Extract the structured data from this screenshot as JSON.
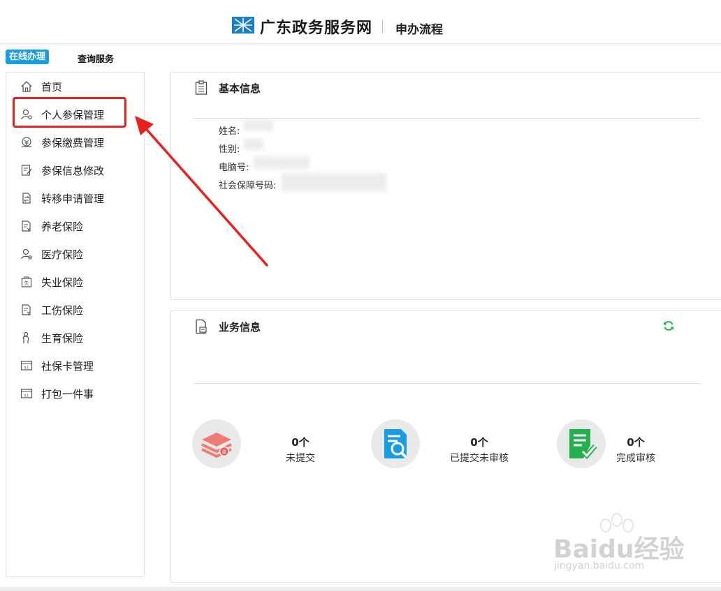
{
  "header": {
    "site_name": "广东政务服务网",
    "subtitle": "申办流程"
  },
  "top_tabs": {
    "online": "在线办理",
    "query": "查询服务"
  },
  "sidebar": {
    "items": [
      {
        "label": "首页",
        "icon": "home-icon"
      },
      {
        "label": "个人参保管理",
        "icon": "user-gear-icon"
      },
      {
        "label": "参保缴费管理",
        "icon": "payment-icon"
      },
      {
        "label": "参保信息修改",
        "icon": "edit-doc-icon"
      },
      {
        "label": "转移申请管理",
        "icon": "transfer-icon"
      },
      {
        "label": "养老保险",
        "icon": "pension-doc-icon"
      },
      {
        "label": "医疗保险",
        "icon": "medical-user-icon"
      },
      {
        "label": "失业保险",
        "icon": "unemployment-icon"
      },
      {
        "label": "工伤保险",
        "icon": "injury-doc-icon"
      },
      {
        "label": "生育保险",
        "icon": "maternity-icon"
      },
      {
        "label": "社保卡管理",
        "icon": "si-card-icon"
      },
      {
        "label": "打包一件事",
        "icon": "si-card-icon"
      }
    ],
    "highlighted_index": 1
  },
  "basic_info": {
    "title": "基本信息",
    "fields": [
      {
        "label": "姓名:"
      },
      {
        "label": "性别:"
      },
      {
        "label": "电脑号:"
      },
      {
        "label": "社会保障号码:"
      }
    ]
  },
  "business_info": {
    "title": "业务信息",
    "stats": [
      {
        "count": "0个",
        "label": "未提交",
        "icon": "unsubmitted-stack-icon"
      },
      {
        "count": "0个",
        "label": "已提交未审核",
        "icon": "search-doc-icon"
      },
      {
        "count": "0个",
        "label": "完成审核",
        "icon": "approved-doc-icon"
      }
    ]
  },
  "watermark": {
    "text": "Baidu经验",
    "url_text": "jingyan.baidu.com"
  },
  "colors": {
    "accent": "#1a9ce0",
    "highlight": "#e8201f",
    "green": "#22b14c"
  }
}
